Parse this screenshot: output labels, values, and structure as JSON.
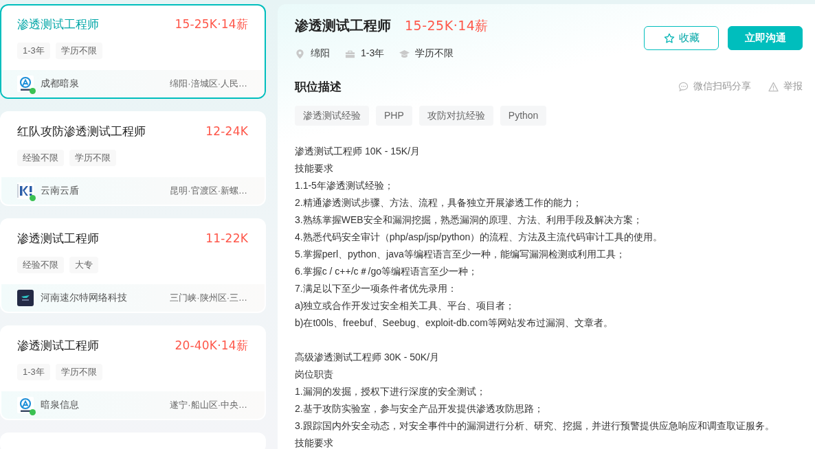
{
  "job_list": [
    {
      "title": "渗透测试工程师",
      "salary": "15-25K·14薪",
      "selected": true,
      "tags": [
        "1-3年",
        "学历不限"
      ],
      "company": "成都暗泉",
      "location": "绵阳·涪城区·人民…",
      "logo": {
        "kind": "ring",
        "online": true
      }
    },
    {
      "title": "红队攻防渗透测试工程师",
      "salary": "12-24K",
      "selected": false,
      "tags": [
        "经验不限",
        "学历不限"
      ],
      "company": "云南云盾",
      "location": "昆明·官渡区·新螺…",
      "logo": {
        "kind": "blocks",
        "online": true
      }
    },
    {
      "title": "渗透测试工程师",
      "salary": "11-22K",
      "selected": false,
      "tags": [
        "经验不限",
        "大专"
      ],
      "company": "河南速尔特网络科技",
      "location": "三门峡·陕州区·三…",
      "logo": {
        "kind": "dark-tile",
        "online": false
      }
    },
    {
      "title": "渗透测试工程师",
      "salary": "20-40K·14薪",
      "selected": false,
      "tags": [
        "1-3年",
        "学历不限"
      ],
      "company": "暗泉信息",
      "location": "遂宁·船山区·中央…",
      "logo": {
        "kind": "ring",
        "online": true
      }
    }
  ],
  "detail": {
    "title": "渗透测试工程师",
    "salary": "15-25K·14薪",
    "info": [
      {
        "kind": "location",
        "text": "绵阳"
      },
      {
        "kind": "experience",
        "text": "1-3年"
      },
      {
        "kind": "education",
        "text": "学历不限"
      }
    ],
    "buttons": [
      {
        "kind": "outline",
        "label": "收藏"
      },
      {
        "kind": "primary",
        "label": "立即沟通"
      }
    ],
    "section_title": "职位描述",
    "actions": [
      {
        "kind": "share",
        "label": "微信扫码分享"
      },
      {
        "kind": "report",
        "label": "举报"
      }
    ],
    "skills": [
      "渗透测试经验",
      "PHP",
      "攻防对抗经验",
      "Python"
    ],
    "description": [
      {
        "lines": [
          "渗透测试工程师 10K - 15K/月",
          "技能要求",
          "1.1-5年渗透测试经验；",
          "2.精通渗透测试步骤、方法、流程，具备独立开展渗透工作的能力；",
          "3.熟练掌握WEB安全和漏洞挖掘，熟悉漏洞的原理、方法、利用手段及解决方案；",
          "4.熟悉代码安全审计（php/asp/jsp/python）的流程、方法及主流代码审计工具的使用。",
          "5.掌握perl、python、java等编程语言至少一种，能编写漏洞检测或利用工具；",
          "6.掌握c / c++/c＃/go等编程语言至少一种；",
          "7.满足以下至少一项条件者优先录用：",
          "a)独立或合作开发过安全相关工具、平台、项目者；",
          "b)在t00ls、freebuf、Seebug、exploit-db.com等网站发布过漏洞、文章者。"
        ]
      },
      {
        "lines": [
          "高级渗透测试工程师 30K - 50K/月",
          "岗位职责",
          "1.漏洞的发掘，授权下进行深度的安全测试；",
          "2.基于攻防实验室，参与安全产品开发提供渗透攻防思路；",
          "3.跟踪国内外安全动态，对安全事件中的漏洞进行分析、研究、挖掘，并进行预警提供应急响应和调查取证服务。",
          "技能要求"
        ]
      }
    ]
  }
}
